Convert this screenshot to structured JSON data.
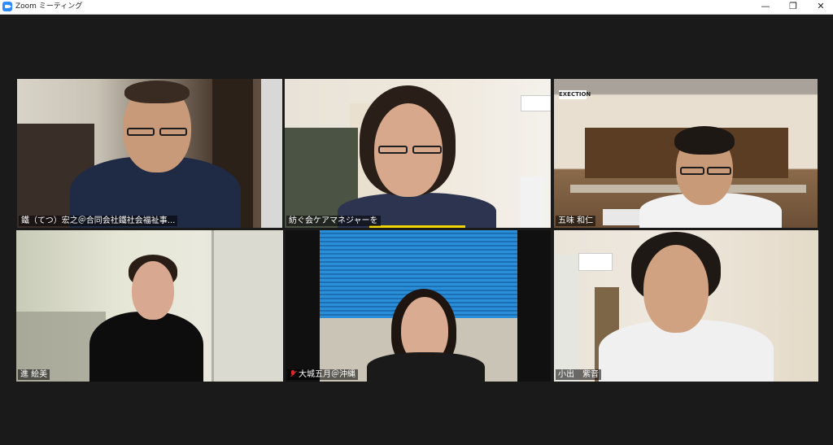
{
  "window": {
    "title": "Zoom ミーティング",
    "controls": {
      "minimize": "—",
      "maximize": "❐",
      "close": "✕"
    }
  },
  "participants": [
    {
      "name": "鐵（てつ）宏之＠合同会社鐵社会福祉事...",
      "muted": false,
      "active_speaker": false
    },
    {
      "name": "紡ぐ会ケアマネジャーを",
      "muted": false,
      "active_speaker": false
    },
    {
      "name": "五味 和仁",
      "muted": false,
      "active_speaker": false
    },
    {
      "name": "進 絵美",
      "muted": false,
      "active_speaker": true
    },
    {
      "name": "大城五月＠沖縄",
      "muted": true,
      "active_speaker": false
    },
    {
      "name": "小出　紫音",
      "muted": false,
      "active_speaker": false
    }
  ],
  "background_sign": "EXECTION",
  "colors": {
    "active_border": "#d8e35a",
    "background": "#1a1a1a",
    "muted_icon": "#e02828"
  }
}
